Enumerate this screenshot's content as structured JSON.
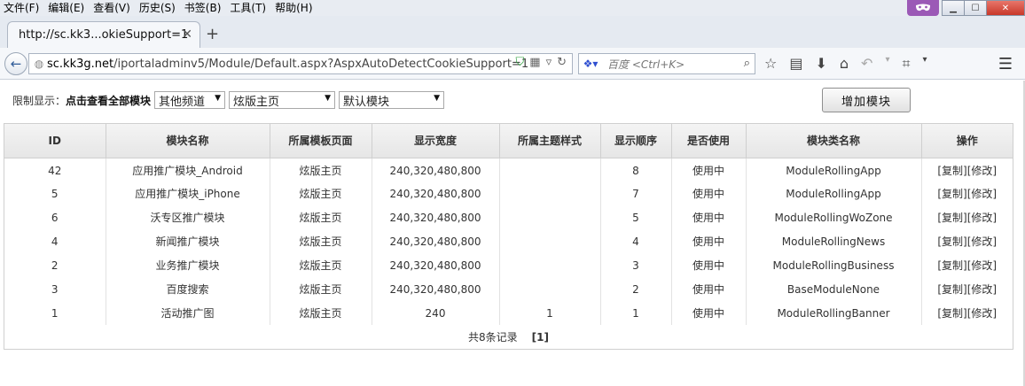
{
  "menu": {
    "items": [
      "文件(F)",
      "编辑(E)",
      "查看(V)",
      "历史(S)",
      "书签(B)",
      "工具(T)",
      "帮助(H)"
    ]
  },
  "tab": {
    "title": "http://sc.kk3...okieSupport=1"
  },
  "urlbar": {
    "host": "sc.kk3g.net",
    "path": "/iportaladminv5/Module/Default.aspx?AspxAutoDetectCookieSupport=1"
  },
  "search": {
    "placeholder": "百度 <Ctrl+K>"
  },
  "filter": {
    "label": "限制显示：",
    "show_all": "点击查看全部模块",
    "channel": "其他频道",
    "page": "炫版主页",
    "module": "默认模块"
  },
  "add_button": "增加模块",
  "table": {
    "headers": [
      "ID",
      "模块名称",
      "所属模板页面",
      "显示宽度",
      "所属主题样式",
      "显示顺序",
      "是否使用",
      "模块类名称",
      "操作"
    ],
    "rows": [
      {
        "id": "42",
        "name": "应用推广模块_Android",
        "page": "炫版主页",
        "width": "240,320,480,800",
        "theme": "",
        "order": "8",
        "status": "使用中",
        "class": "ModuleRollingApp",
        "copy": "[复制]",
        "edit": "[修改]"
      },
      {
        "id": "5",
        "name": "应用推广模块_iPhone",
        "page": "炫版主页",
        "width": "240,320,480,800",
        "theme": "",
        "order": "7",
        "status": "使用中",
        "class": "ModuleRollingApp",
        "copy": "[复制]",
        "edit": "[修改]"
      },
      {
        "id": "6",
        "name": "沃专区推广模块",
        "page": "炫版主页",
        "width": "240,320,480,800",
        "theme": "",
        "order": "5",
        "status": "使用中",
        "class": "ModuleRollingWoZone",
        "copy": "[复制]",
        "edit": "[修改]"
      },
      {
        "id": "4",
        "name": "新闻推广模块",
        "page": "炫版主页",
        "width": "240,320,480,800",
        "theme": "",
        "order": "4",
        "status": "使用中",
        "class": "ModuleRollingNews",
        "copy": "[复制]",
        "edit": "[修改]"
      },
      {
        "id": "2",
        "name": "业务推广模块",
        "page": "炫版主页",
        "width": "240,320,480,800",
        "theme": "",
        "order": "3",
        "status": "使用中",
        "class": "ModuleRollingBusiness",
        "copy": "[复制]",
        "edit": "[修改]"
      },
      {
        "id": "3",
        "name": "百度搜索",
        "page": "炫版主页",
        "width": "240,320,480,800",
        "theme": "",
        "order": "2",
        "status": "使用中",
        "class": "BaseModuleNone",
        "copy": "[复制]",
        "edit": "[修改]"
      },
      {
        "id": "1",
        "name": "活动推广图",
        "page": "炫版主页",
        "width": "240",
        "theme": "1",
        "order": "1",
        "status": "使用中",
        "class": "ModuleRollingBanner",
        "copy": "[复制]",
        "edit": "[修改]"
      }
    ]
  },
  "pager": {
    "summary": "共8条记录",
    "current": "[1]"
  },
  "colors": {
    "accent": "#2f5c98",
    "mask": "#9b59b6",
    "close": "#c8382a"
  },
  "icons": [
    "mask-icon",
    "minimize-icon",
    "maximize-icon",
    "close-icon",
    "back-arrow-icon",
    "globe-icon",
    "shield-icon",
    "qr-icon",
    "reload-icon",
    "baidu-paw-icon",
    "search-icon",
    "star-icon",
    "reading-list-icon",
    "download-icon",
    "home-icon",
    "undo-icon",
    "crop-icon",
    "menu-icon"
  ]
}
